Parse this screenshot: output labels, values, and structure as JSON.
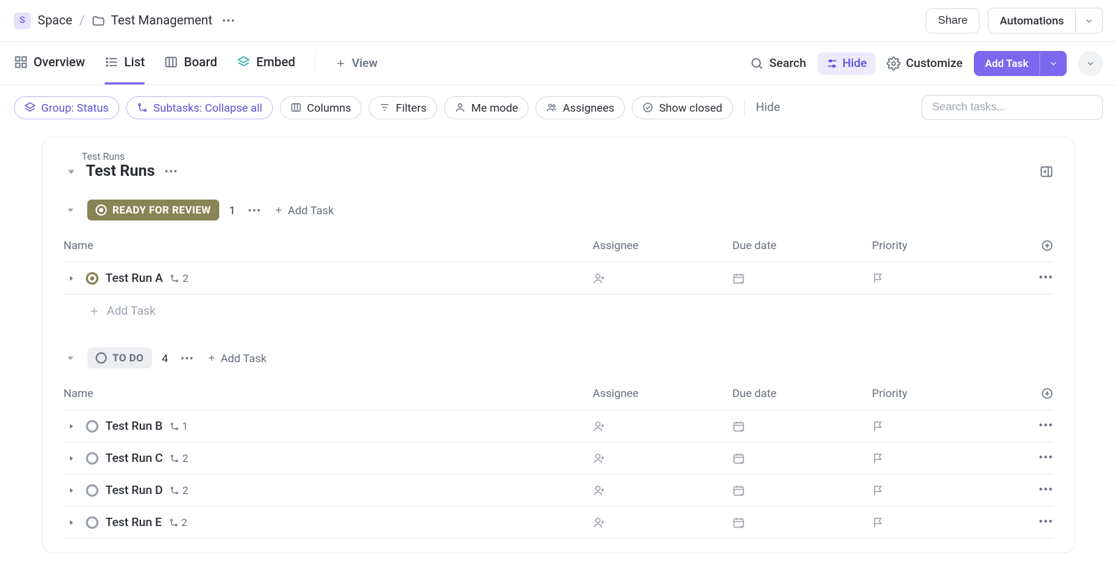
{
  "breadcrumb": {
    "space_badge": "S",
    "space": "Space",
    "folder": "Test Management"
  },
  "topbar": {
    "share": "Share",
    "automations": "Automations"
  },
  "tabs": {
    "overview": "Overview",
    "list": "List",
    "board": "Board",
    "embed": "Embed",
    "add_view": "View",
    "search": "Search",
    "hide": "Hide",
    "customize": "Customize",
    "add_task": "Add Task"
  },
  "filters": {
    "group_status": "Group: Status",
    "subtasks": "Subtasks: Collapse all",
    "columns": "Columns",
    "filters": "Filters",
    "me_mode": "Me mode",
    "assignees": "Assignees",
    "show_closed": "Show closed",
    "hide_link": "Hide",
    "search_placeholder": "Search tasks..."
  },
  "list": {
    "breadcrumb": "Test Runs",
    "title": "Test Runs",
    "columns": {
      "name": "Name",
      "assignee": "Assignee",
      "due": "Due date",
      "priority": "Priority"
    },
    "add_task_label": "Add Task",
    "groups": [
      {
        "status_key": "review",
        "status_label": "READY FOR REVIEW",
        "count": "1",
        "tasks": [
          {
            "name": "Test Run A",
            "subtasks": "2",
            "status": "review"
          }
        ]
      },
      {
        "status_key": "todo",
        "status_label": "TO DO",
        "count": "4",
        "tasks": [
          {
            "name": "Test Run B",
            "subtasks": "1",
            "status": "todo"
          },
          {
            "name": "Test Run C",
            "subtasks": "2",
            "status": "todo"
          },
          {
            "name": "Test Run D",
            "subtasks": "2",
            "status": "todo"
          },
          {
            "name": "Test Run E",
            "subtasks": "2",
            "status": "todo"
          }
        ]
      }
    ]
  }
}
